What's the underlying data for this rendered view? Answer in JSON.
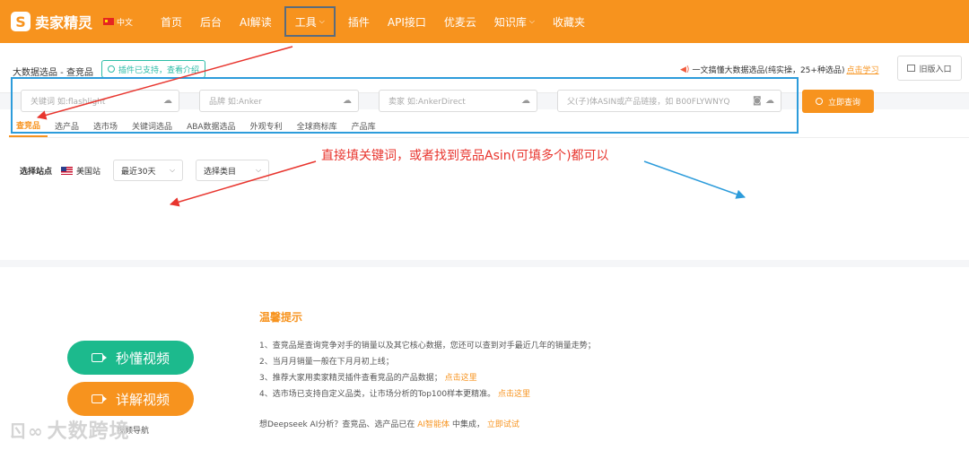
{
  "header": {
    "logo_mark": "S",
    "logo_text": "卖家精灵",
    "lang": "中文",
    "nav": [
      {
        "label": "首页",
        "caret": false
      },
      {
        "label": "后台",
        "caret": false
      },
      {
        "label": "AI解读",
        "caret": false
      },
      {
        "label": "工具",
        "caret": true
      },
      {
        "label": "插件",
        "caret": false
      },
      {
        "label": "API接口",
        "caret": false
      },
      {
        "label": "优麦云",
        "caret": false
      },
      {
        "label": "知识库",
        "caret": true
      },
      {
        "label": "收藏夹",
        "caret": false
      }
    ]
  },
  "subheader": {
    "breadcrumb": "大数据选品 - 查竞品",
    "plugin_badge": "插件已支持，查看介绍",
    "notice": "一文搞懂大数据选品(纯实操，25+种选品)",
    "notice_link": "点击学习",
    "old_version": "旧版入口"
  },
  "tabs": [
    "查竞品",
    "选产品",
    "选市场",
    "关键词选品",
    "ABA数据选品",
    "外观专利",
    "全球商标库",
    "产品库"
  ],
  "filters": {
    "label": "选择站点",
    "site": "美国站",
    "period": "最近30天",
    "category": "选择类目"
  },
  "inputs": {
    "keyword": "关键词 如:flashlight",
    "brand": "品牌 如:Anker",
    "seller": "卖家 如:AnkerDirect",
    "asin": "父(子)体ASIN或产品链接，如 B00FLYWNYQ"
  },
  "query_button": "立即查询",
  "annotation": "直接填关键词，或者找到竞品Asin(可填多个)都可以",
  "tips": {
    "title": "温馨提示",
    "items": [
      {
        "text": "1、查竞品是查询竞争对手的销量以及其它核心数据，您还可以查到对手最近几年的销量走势；",
        "link": ""
      },
      {
        "text": "2、当月月销量一般在下月月初上线；",
        "link": ""
      },
      {
        "text": "3、推荐大家用卖家精灵插件查看竞品的产品数据；",
        "link": "点击这里"
      },
      {
        "text": "4、选市场已支持自定义品类，让市场分析的Top100样本更精准。",
        "link": "点击这里"
      }
    ],
    "ai_prefix": "想Deepseek AI分析？查竞品、选产品已在",
    "ai_name": "AI智能体",
    "ai_suffix": "中集成，",
    "ai_link": "立即试试"
  },
  "videos": {
    "quick": "秒懂视频",
    "detail": "详解视频",
    "nav_hint": "视频导航"
  },
  "watermark": "大数跨境",
  "colors": {
    "brand": "#f7931e",
    "green": "#1cba8d",
    "annotation": "#e8352e",
    "highlight_box": "#2d9cdb"
  }
}
